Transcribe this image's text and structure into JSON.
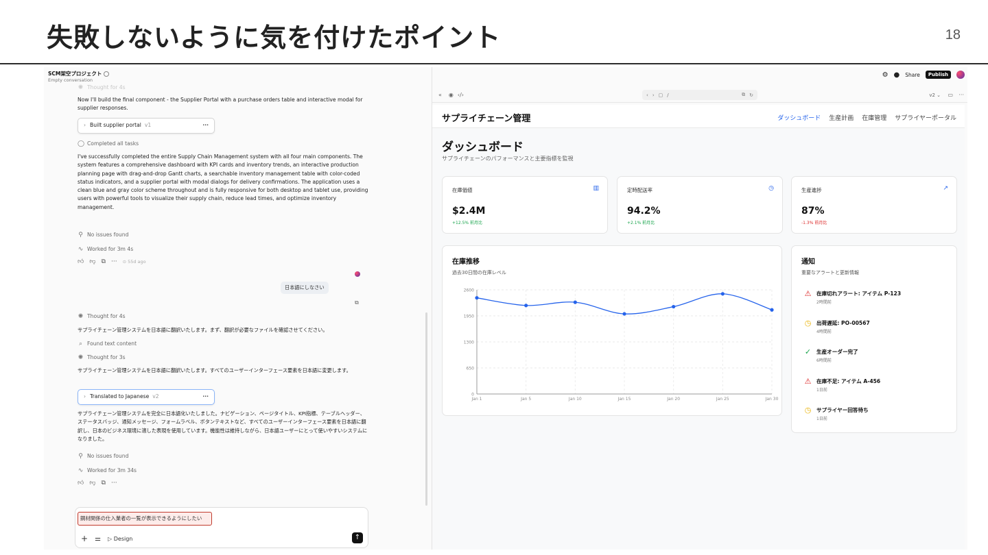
{
  "slide": {
    "title": "失敗しないように気を付けたポイント",
    "page": "18"
  },
  "left": {
    "project": "SCM架空プロジェクト",
    "project_sub": "Empty conversation",
    "faded_top": "Thought for 4s",
    "msg1": "Now I'll build the final component - the Supplier Portal with a purchase orders table and interactive modal for supplier responses.",
    "card1": {
      "label": "Built supplier portal",
      "version": "v1",
      "menu": "···"
    },
    "completed": "Completed all tasks",
    "msg2": "I've successfully completed the entire Supply Chain Management system with all four main components. The system features a comprehensive dashboard with KPI cards and inventory trends, an interactive production planning page with drag-and-drop Gantt charts, a searchable inventory management table with color-coded status indicators, and a supplier portal with modal dialogs for delivery confirmations. The application uses a clean blue and gray color scheme throughout and is fully responsive for both desktop and tablet use, providing users with powerful tools to visualize their supply chain, reduce lead times, and optimize inventory management.",
    "no_issues1": "No issues found",
    "worked1": "Worked for 3m 4s",
    "ago": "55d ago",
    "user_msg": "日本語にしなさい",
    "thought2": "Thought for 4s",
    "msg3": "サプライチェーン管理システムを日本語に翻訳いたします。まず、翻訳が必要なファイルを確認させてください。",
    "found": "Found text content",
    "thought3": "Thought for 3s",
    "msg4": "サプライチェーン管理システムを日本語に翻訳いたします。すべてのユーザーインターフェース要素を日本語に変更します。",
    "card2": {
      "label": "Translated to Japanese",
      "version": "v2",
      "menu": "···"
    },
    "msg5": "サプライチェーン管理システムを完全に日本語化いたしました。ナビゲーション、ページタイトル、KPI指標、テーブルヘッダー、ステータスバッジ、通知メッセージ、フォームラベル、ボタンテキストなど、すべてのユーザーインターフェース要素を日本語に翻訳し、日本のビジネス環境に適した表現を使用しています。機能性は維持しながら、日本語ユーザーにとって使いやすいシステムになりました。",
    "no_issues2": "No issues found",
    "worked2": "Worked for 3m 34s",
    "compose_text": "鋼材関係の仕入業者の一覧が表示できるようにしたい",
    "design_label": "Design"
  },
  "topbar": {
    "share": "Share",
    "publish": "Publish"
  },
  "browser": {
    "path": "/",
    "version": "v2 ⌄"
  },
  "app": {
    "brand": "サプライチェーン管理",
    "nav": [
      "ダッシュボード",
      "生産計画",
      "在庫管理",
      "サプライヤーポータル"
    ],
    "title": "ダッシュボード",
    "subtitle": "サプライチェーンのパフォーマンスと主要指標を監視",
    "kpis": [
      {
        "label": "在庫価値",
        "value": "$2.4M",
        "delta": "+12.5% 前月比",
        "trend": "up"
      },
      {
        "label": "定時配送率",
        "value": "94.2%",
        "delta": "+2.1% 前月比",
        "trend": "up"
      },
      {
        "label": "生産進捗",
        "value": "87%",
        "delta": "-1.3% 前月比",
        "trend": "down"
      }
    ],
    "chart_panel": {
      "title": "在庫推移",
      "subtitle": "過去30日間の在庫レベル"
    },
    "notif_panel": {
      "title": "通知",
      "subtitle": "重要なアラートと更新情報"
    },
    "notifications": [
      {
        "title": "在庫切れアラート: アイテム P-123",
        "time": "2時間前",
        "kind": "alert",
        "color": "#dc2626"
      },
      {
        "title": "出荷遅延: PO-00567",
        "time": "4時間前",
        "kind": "clock",
        "color": "#eab308"
      },
      {
        "title": "生産オーダー完了",
        "time": "6時間前",
        "kind": "check",
        "color": "#16a34a"
      },
      {
        "title": "在庫不足: アイテム A-456",
        "time": "1日前",
        "kind": "alert",
        "color": "#dc2626"
      },
      {
        "title": "サプライヤー回答待ち",
        "time": "1日前",
        "kind": "clock",
        "color": "#eab308"
      }
    ]
  },
  "chart_data": {
    "type": "line",
    "x": [
      "Jan 1",
      "Jan 5",
      "Jan 10",
      "Jan 15",
      "Jan 20",
      "Jan 25",
      "Jan 30"
    ],
    "series": [
      {
        "values": [
          2400,
          2210,
          2290,
          2000,
          2180,
          2500,
          2100
        ]
      }
    ],
    "ylim": [
      0,
      2600
    ],
    "yticks": [
      0,
      650,
      1300,
      1950,
      2600
    ],
    "grid": true,
    "color": "#2563eb"
  }
}
